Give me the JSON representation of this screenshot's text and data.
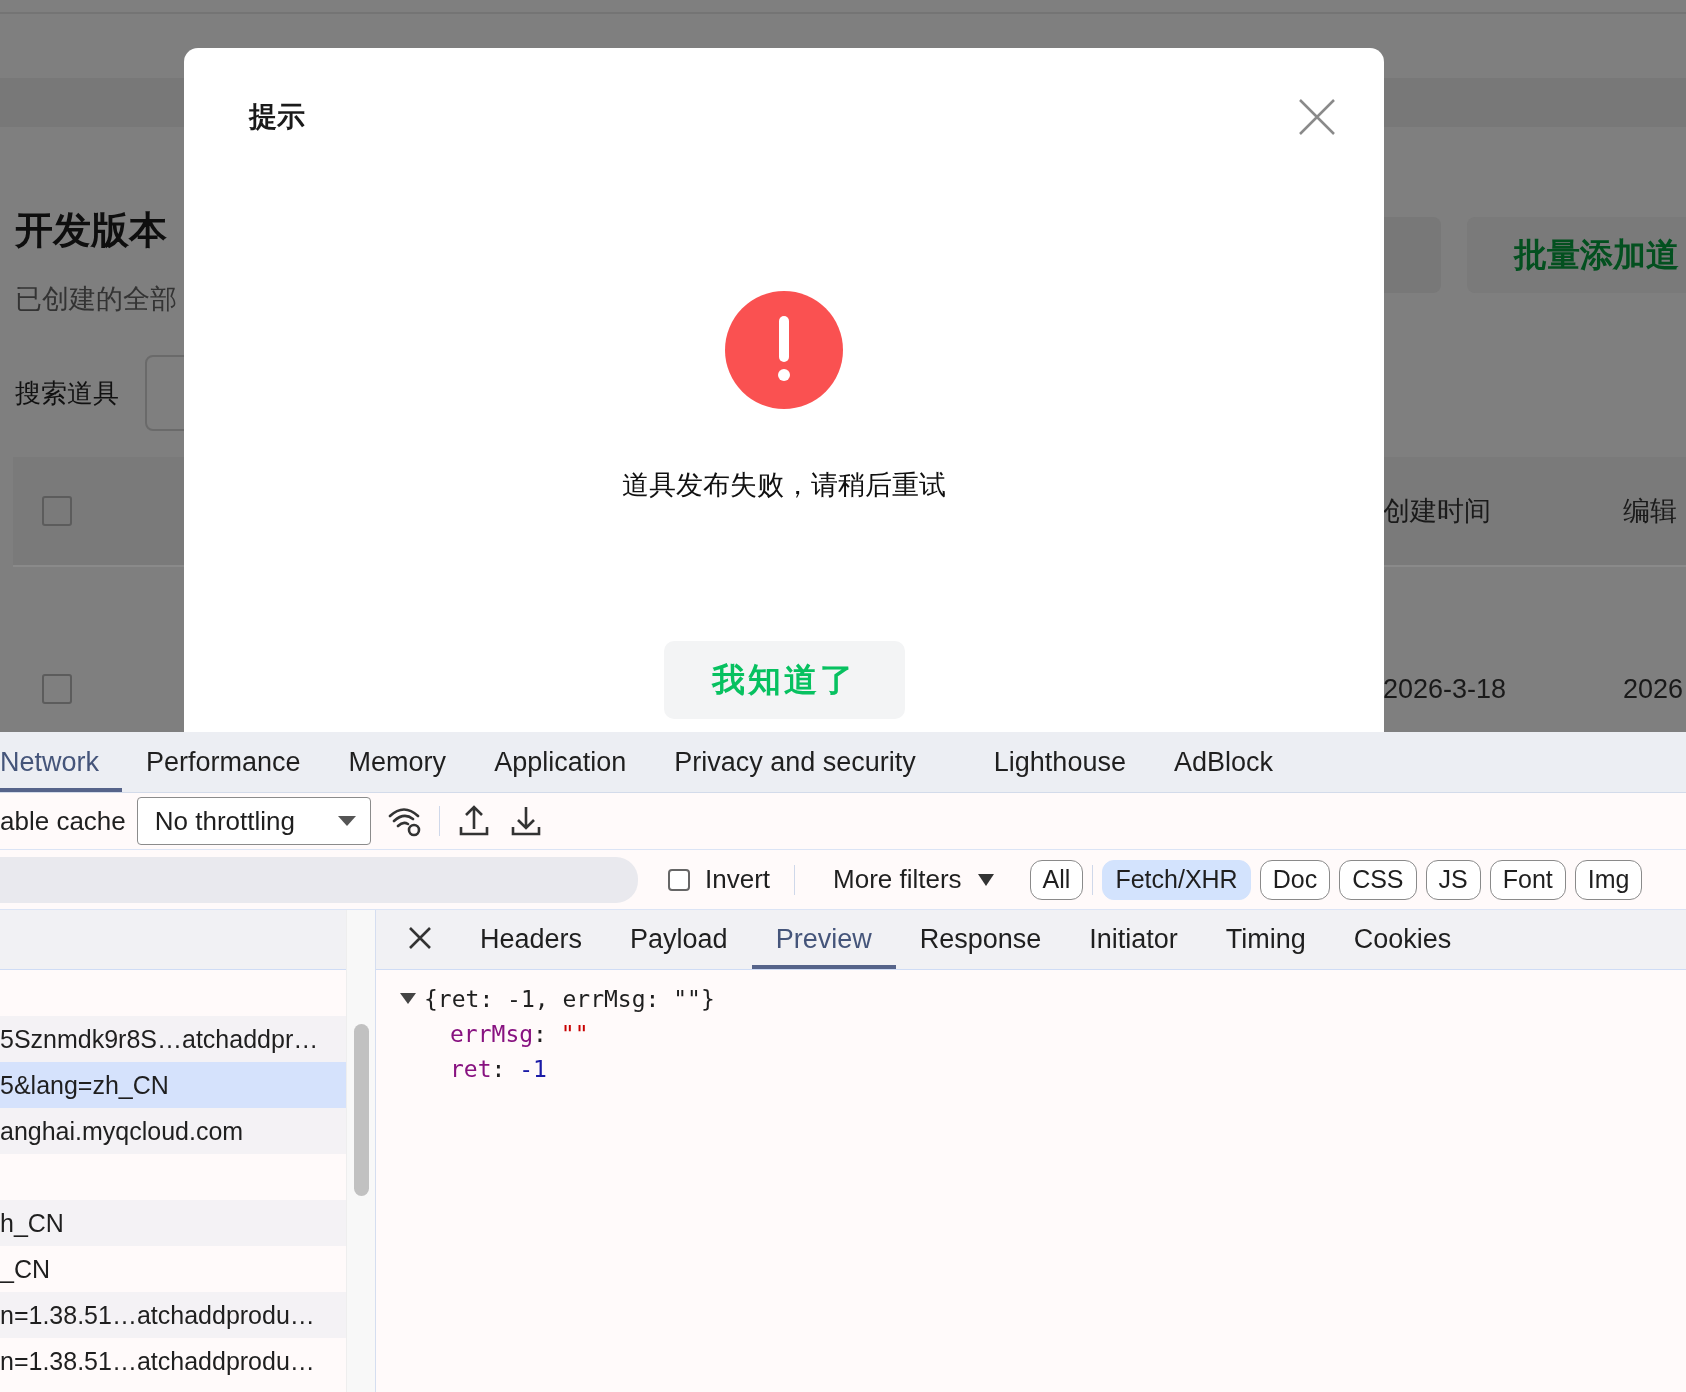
{
  "page": {
    "title": "开发版本",
    "subtitle": "已创建的全部",
    "search_label": "搜索道具",
    "batch_button": "批量添加道",
    "table": {
      "header_checked": false,
      "columns": [
        "创建时间",
        "编辑"
      ],
      "rows": [
        {
          "checked": false,
          "cells": [
            "2026-3-18",
            "2026"
          ]
        }
      ]
    }
  },
  "dialog": {
    "title": "提示",
    "message": "道具发布失败，请稍后重试",
    "button": "我知道了"
  },
  "devtools": {
    "tabs": [
      {
        "label": "Network",
        "selected": true
      },
      {
        "label": "Performance",
        "selected": false
      },
      {
        "label": "Memory",
        "selected": false
      },
      {
        "label": "Application",
        "selected": false
      },
      {
        "label": "Privacy and security",
        "selected": false
      },
      {
        "label": "Lighthouse",
        "selected": false
      },
      {
        "label": "AdBlock",
        "selected": false
      }
    ],
    "toolbar": {
      "cache_label": "able cache",
      "throttling": "No throttling"
    },
    "filter_bar": {
      "invert": {
        "label": "Invert",
        "checked": false
      },
      "more_filters": "More filters",
      "types": [
        {
          "label": "All",
          "selected": false
        },
        {
          "label": "Fetch/XHR",
          "selected": true
        },
        {
          "label": "Doc",
          "selected": false
        },
        {
          "label": "CSS",
          "selected": false
        },
        {
          "label": "JS",
          "selected": false
        },
        {
          "label": "Font",
          "selected": false
        },
        {
          "label": "Img",
          "selected": false
        }
      ]
    },
    "requests": [
      {
        "kind": "blank"
      },
      {
        "kind": "request",
        "name": "5Sznmdk9r8S…atchaddpr…",
        "selected": false
      },
      {
        "kind": "request",
        "name": "5&lang=zh_CN",
        "selected": true
      },
      {
        "kind": "request",
        "name": "anghai.myqcloud.com",
        "selected": false
      },
      {
        "kind": "blank"
      },
      {
        "kind": "request",
        "name": "h_CN",
        "selected": false
      },
      {
        "kind": "request",
        "name": "_CN",
        "selected": false
      },
      {
        "kind": "request",
        "name": "n=1.38.51…atchaddprodu…",
        "selected": false
      },
      {
        "kind": "request",
        "name": "n=1.38.51…atchaddprodu…",
        "selected": false
      }
    ],
    "detail_tabs": [
      {
        "label": "Headers",
        "selected": false
      },
      {
        "label": "Payload",
        "selected": false
      },
      {
        "label": "Preview",
        "selected": true
      },
      {
        "label": "Response",
        "selected": false
      },
      {
        "label": "Initiator",
        "selected": false
      },
      {
        "label": "Timing",
        "selected": false
      },
      {
        "label": "Cookies",
        "selected": false
      }
    ],
    "preview": {
      "summary": "{ret: -1, errMsg: \"\"}",
      "expanded": true,
      "separator": ":",
      "properties": [
        {
          "key": "errMsg",
          "value": "\"\"",
          "kind": "string"
        },
        {
          "key": "ret",
          "value": "-1",
          "kind": "number"
        }
      ]
    }
  }
}
